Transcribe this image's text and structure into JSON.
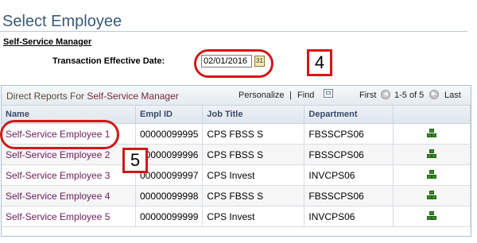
{
  "page": {
    "title": "Select Employee",
    "subtitle": "Self-Service Manager"
  },
  "effective_date": {
    "label": "Transaction Effective Date:",
    "value": "02/01/2016"
  },
  "annotations": {
    "box_4": "4",
    "box_5": "5"
  },
  "grid": {
    "title_prefix": "Direct Reports For",
    "title_manager": "Self-Service Manager",
    "personalize": "Personalize",
    "separator": "|",
    "find": "Find",
    "first": "First",
    "range": "1-5 of 5",
    "last": "Last",
    "columns": [
      "Name",
      "Empl ID",
      "Job Title",
      "Department"
    ],
    "rows": [
      {
        "name": "Self-Service Employee 1",
        "empl_id": "00000099995",
        "job_title": "CPS FBSS S",
        "department": "FBSSCPS06"
      },
      {
        "name": "Self-Service Employee 2",
        "empl_id": "00000099996",
        "job_title": "CPS FBSS S",
        "department": "FBSSCPS06"
      },
      {
        "name": "Self-Service Employee 3",
        "empl_id": "00000099997",
        "job_title": "CPS Invest",
        "department": "INVCPS06"
      },
      {
        "name": "Self-Service Employee 4",
        "empl_id": "00000099998",
        "job_title": "CPS FBSS S",
        "department": "FBSSCPS06"
      },
      {
        "name": "Self-Service Employee 5",
        "empl_id": "00000099999",
        "job_title": "CPS Invest",
        "department": "INVCPS06"
      }
    ]
  },
  "icons": {
    "calendar": "calendar-icon",
    "zoom": "zoom-grid-icon",
    "prev": "previous-arrow-icon",
    "next": "next-arrow-icon",
    "org_chart": "org-chart-icon"
  },
  "colors": {
    "annotation": "#d01818",
    "link": "#6b1d5c"
  }
}
